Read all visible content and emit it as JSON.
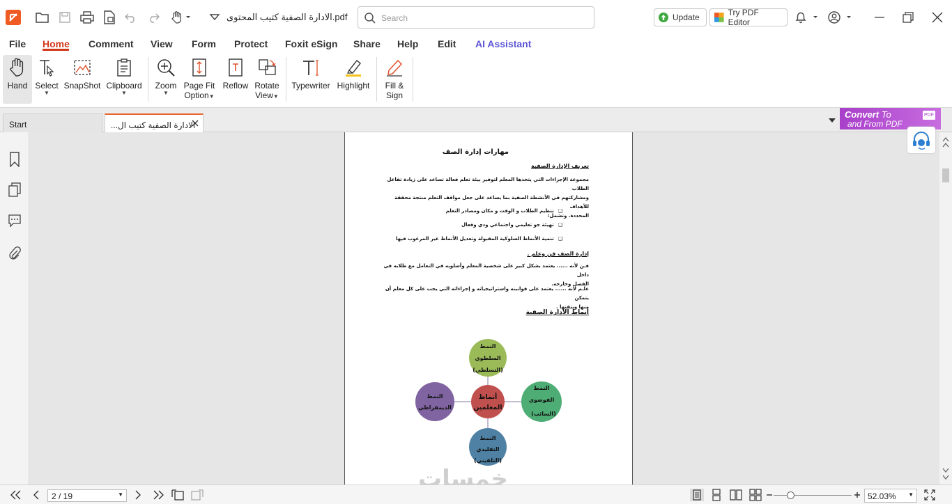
{
  "titlebar": {
    "doc_title": "الادارة الصفية كتيب المحتوى.pdf",
    "search_placeholder": "Search",
    "update_label": "Update",
    "try_editor_label": "Try PDF Editor"
  },
  "menu": {
    "items": [
      "File",
      "Home",
      "Comment",
      "View",
      "Form",
      "Protect",
      "Foxit eSign",
      "Share",
      "Help",
      "Edit",
      "AI Assistant"
    ],
    "active": "Home"
  },
  "ribbon": {
    "tools": [
      {
        "label": "Hand",
        "icon": "hand-icon"
      },
      {
        "label": "Select",
        "icon": "select-text-icon"
      },
      {
        "label": "SnapShot",
        "icon": "snapshot-icon"
      },
      {
        "label": "Clipboard",
        "icon": "clipboard-icon"
      },
      {
        "label": "Zoom",
        "icon": "zoom-icon"
      },
      {
        "label": "Page Fit",
        "label2": "Option",
        "icon": "page-fit-icon"
      },
      {
        "label": "Reflow",
        "icon": "reflow-icon"
      },
      {
        "label": "Rotate",
        "label2": "View",
        "icon": "rotate-icon"
      },
      {
        "label": "Typewriter",
        "icon": "typewriter-icon"
      },
      {
        "label": "Highlight",
        "icon": "highlight-icon"
      },
      {
        "label": "Fill &",
        "label2": "Sign",
        "icon": "fill-sign-icon"
      }
    ]
  },
  "tabs": {
    "start": "Start",
    "doc": "...الادارة الصفية كتيب ال"
  },
  "banner": {
    "line1_bold": "Convert",
    "line1_rest": " To",
    "line2": "and From PDF",
    "badge": "PDF"
  },
  "pdf": {
    "title": "مهارات إدارة الصف",
    "h1": "تعريف الإدارة الصفية",
    "p1_line1": "مجموعة الإجراءات التي يتخذها المعلم لتوفير بيئة تعلم فعالة تساعد على زيادة تفاعل الطلاب",
    "p1_line2": "ومشاركتهم في الأنشطة الصفية بما يساعد على جعل مواقف التعلم منتجة محققة للأهداف",
    "p1_line3": "المحددة. وتشمل:",
    "bullets": [
      "تنظيم الطلاب و الوقت و مكان ومصادر التعلم",
      "تهيئة جو تعليمي واجتماعي ودي وفعال",
      "تنمية الأنماط السلوكية المقبولة وتعديل الأنماط غير المرغوب فيها"
    ],
    "h2": "إدارة الصف فن وعلم .",
    "art_line1": "فـن لأنه ...... يعتمد بشكل كبير على شخصية المعلم وأسلوبه في التعامل مع طلابه في داخل",
    "art_line2": "الفصل وخارجه.",
    "sci_line1": "علـم لأنه ...... يعتمد على قوانينه واستراتيجياته و إجراءاته التي يجب على كل معلم أن يتمكن",
    "sci_line2": "منها ويتقنها .",
    "h3": "أنماط الادارة الصفية",
    "diagram": {
      "center": [
        "أنماط",
        "المعلمين"
      ],
      "top": [
        "النمط",
        "السلطوي",
        "(التسلطي)"
      ],
      "right": [
        "النمط",
        "الفوضوي",
        "(السائب)"
      ],
      "bottom": [
        "النمط",
        "التقليدي",
        "(التلقيني)"
      ],
      "left": [
        "النمط",
        "الديمقراطي"
      ],
      "colors": {
        "center": "#c0504d",
        "top": "#9bbb59",
        "right": "#4ead74",
        "bottom": "#4f81a4",
        "left": "#8064a2"
      }
    }
  },
  "watermark": "خمسات",
  "status": {
    "page": "2 / 19",
    "zoom": "52.03%",
    "zoom_fraction": 0.22
  }
}
